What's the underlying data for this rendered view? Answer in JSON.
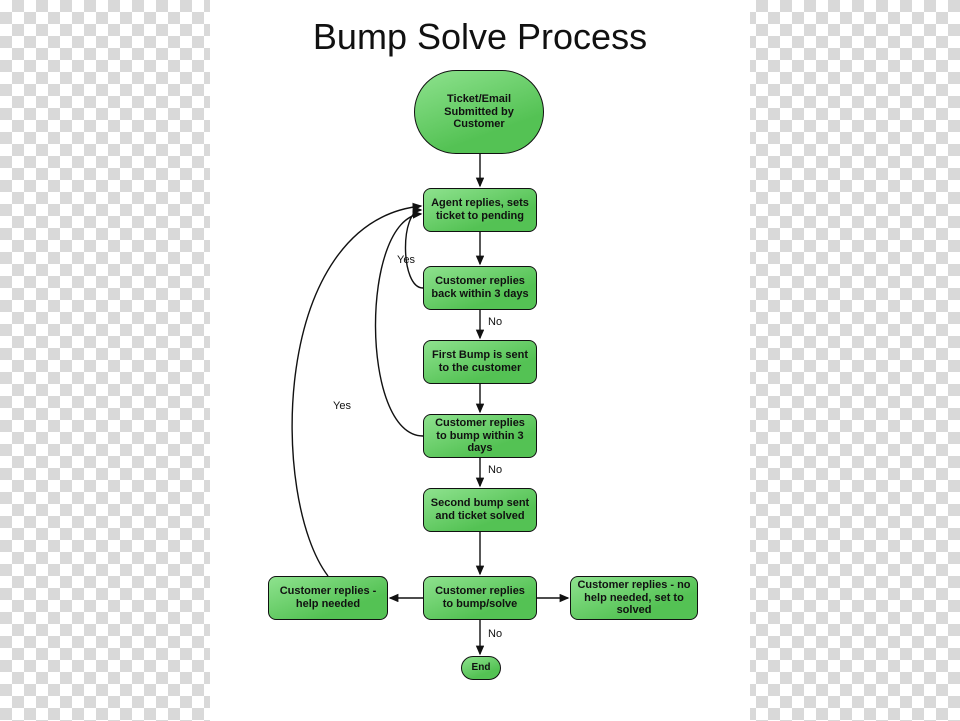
{
  "title": "Bump Solve Process",
  "nodes": {
    "start": {
      "label": "Ticket/Email Submitted by Customer"
    },
    "agent": {
      "label": "Agent replies, sets ticket to pending"
    },
    "cust3a": {
      "label": "Customer replies back within 3 days"
    },
    "firstBump": {
      "label": "First Bump is sent to the customer"
    },
    "cust3b": {
      "label": "Customer replies to bump within 3 days"
    },
    "secondBump": {
      "label": "Second bump sent and ticket solved"
    },
    "bumpSolve": {
      "label": "Customer replies to bump/solve"
    },
    "helpNeeded": {
      "label": "Customer replies - help needed"
    },
    "noHelp": {
      "label": "Customer replies - no help needed, set to solved"
    },
    "end": {
      "label": "End"
    }
  },
  "edgeLabels": {
    "yes1": "Yes",
    "no1": "No",
    "no2": "No",
    "yes2": "Yes",
    "no3": "No"
  },
  "colors": {
    "node_fill": "#54c254",
    "node_stroke": "#111111"
  }
}
